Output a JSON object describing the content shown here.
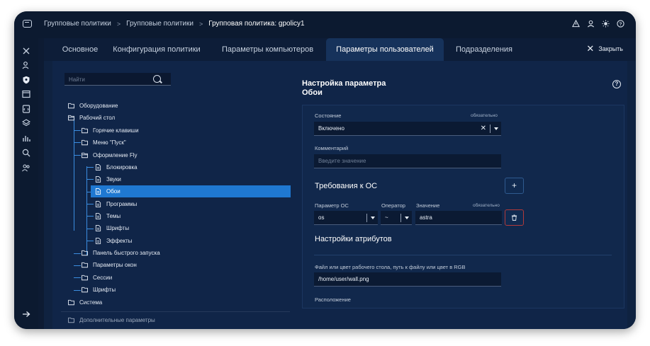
{
  "breadcrumb": {
    "items": [
      "Групповые политики",
      "Групповые политики",
      "Групповая политика: gpolicy1"
    ],
    "separator": ">"
  },
  "tabs": [
    {
      "label": "Основное",
      "active": false
    },
    {
      "label": "Конфигурация политики",
      "active": false
    },
    {
      "label": "Параметры компьютеров",
      "active": false
    },
    {
      "label": "Параметры пользователей",
      "active": true
    },
    {
      "label": "Подразделения",
      "active": false
    }
  ],
  "close_label": "Закрыть",
  "search": {
    "placeholder": "Найти"
  },
  "tree": [
    {
      "label": "Оборудование",
      "icon": "folder-icon"
    },
    {
      "label": "Рабочий стол",
      "icon": "folder-open-icon"
    },
    {
      "label": "Горячие клавиши",
      "icon": "folder-icon"
    },
    {
      "label": "Меню \"Пуск\"",
      "icon": "folder-icon"
    },
    {
      "label": "Оформление Fly",
      "icon": "folder-open-icon"
    },
    {
      "label": "Блокировка",
      "icon": "file-icon"
    },
    {
      "label": "Звуки",
      "icon": "file-icon"
    },
    {
      "label": "Обои",
      "icon": "file-icon",
      "selected": true
    },
    {
      "label": "Программы",
      "icon": "file-icon"
    },
    {
      "label": "Темы",
      "icon": "file-icon"
    },
    {
      "label": "Шрифты",
      "icon": "file-icon"
    },
    {
      "label": "Эффекты",
      "icon": "file-icon"
    },
    {
      "label": "Панель быстрого запуска",
      "icon": "folder-icon"
    },
    {
      "label": "Параметры окон",
      "icon": "folder-icon"
    },
    {
      "label": "Сессии",
      "icon": "folder-icon"
    },
    {
      "label": "Шрифты",
      "icon": "folder-icon"
    },
    {
      "label": "Система",
      "icon": "folder-icon"
    },
    {
      "label": "Дополнительные параметры",
      "icon": "folder-icon"
    }
  ],
  "panel": {
    "title_line1": "Настройка параметра",
    "title_line2": "Обои",
    "state_label": "Состояние",
    "required": "обязательно",
    "state_value": "Включено",
    "comment_label": "Комментарий",
    "comment_placeholder": "Введите значение",
    "os_req_title": "Требования к ОС",
    "os_param_label": "Параметр ОС",
    "operator_label": "Оператор",
    "value_label": "Значение",
    "os_param_value": "os",
    "operator_value": "~",
    "value_value": "astra",
    "attr_title": "Настройки атрибутов",
    "file_label": "Файл или цвет рабочего стола, путь к файлу или цвет в RGB",
    "file_value": "/home/user/wall.png",
    "location_label": "Расположение"
  },
  "colors": {
    "frame_bg": "#0d1b33",
    "selected": "#1f78d1",
    "tree_line": "#3b8de0",
    "delete_border": "#b23a3a"
  }
}
